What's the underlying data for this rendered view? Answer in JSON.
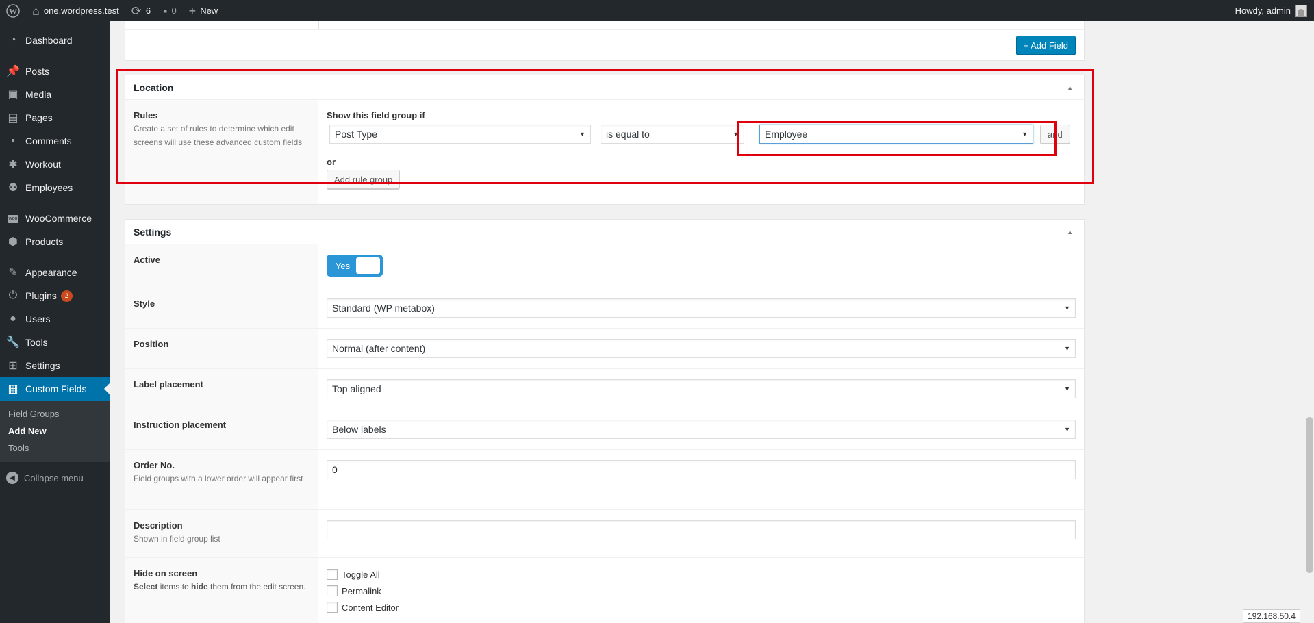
{
  "adminbar": {
    "site_name": "one.wordpress.test",
    "updates_count": "6",
    "comments_count": "0",
    "new_label": "New",
    "howdy": "Howdy, admin"
  },
  "sidebar": {
    "items": [
      {
        "label": "Dashboard",
        "icon": "dashboard-icon"
      },
      {
        "label": "Posts",
        "icon": "pin-icon"
      },
      {
        "label": "Media",
        "icon": "media-icon"
      },
      {
        "label": "Pages",
        "icon": "pages-icon"
      },
      {
        "label": "Comments",
        "icon": "comments-icon"
      },
      {
        "label": "Workout",
        "icon": "person-icon"
      },
      {
        "label": "Employees",
        "icon": "groups-icon"
      },
      {
        "label": "WooCommerce",
        "icon": "woo-icon"
      },
      {
        "label": "Products",
        "icon": "box-icon"
      },
      {
        "label": "Appearance",
        "icon": "brush-icon"
      },
      {
        "label": "Plugins",
        "icon": "plugin-icon",
        "badge": "2"
      },
      {
        "label": "Users",
        "icon": "users-icon"
      },
      {
        "label": "Tools",
        "icon": "wrench-icon"
      },
      {
        "label": "Settings",
        "icon": "settings-icon"
      },
      {
        "label": "Custom Fields",
        "icon": "custom-fields-icon"
      }
    ],
    "submenu": [
      "Field Groups",
      "Add New",
      "Tools"
    ],
    "collapse": "Collapse menu"
  },
  "fields_box": {
    "add_field": "+ Add Field"
  },
  "location": {
    "title": "Location",
    "rules_label": "Rules",
    "rules_desc": "Create a set of rules to determine which edit screens will use these advanced custom fields",
    "show_if": "Show this field group if",
    "param": "Post Type",
    "operator": "is equal to",
    "value": "Employee",
    "and_label": "and",
    "or_label": "or",
    "add_rule_group": "Add rule group"
  },
  "settings": {
    "title": "Settings",
    "active_label": "Active",
    "active_value": "Yes",
    "style_label": "Style",
    "style_value": "Standard (WP metabox)",
    "position_label": "Position",
    "position_value": "Normal (after content)",
    "label_placement_label": "Label placement",
    "label_placement_value": "Top aligned",
    "instruction_label": "Instruction placement",
    "instruction_value": "Below labels",
    "order_label": "Order No.",
    "order_desc": "Field groups with a lower order will appear first",
    "order_value": "0",
    "description_label": "Description",
    "description_desc": "Shown in field group list",
    "description_value": "",
    "hide_label": "Hide on screen",
    "hide_desc_select": "Select",
    "hide_desc_mid": " items to ",
    "hide_desc_hide": "hide",
    "hide_desc_end": " them from the edit screen.",
    "hide_options": [
      "Toggle All",
      "Permalink",
      "Content Editor"
    ]
  },
  "footer": {
    "ip": "192.168.50.4"
  },
  "colors": {
    "accent": "#0073aa",
    "highlight": "#e0000d",
    "toggle": "#2a96d7"
  }
}
